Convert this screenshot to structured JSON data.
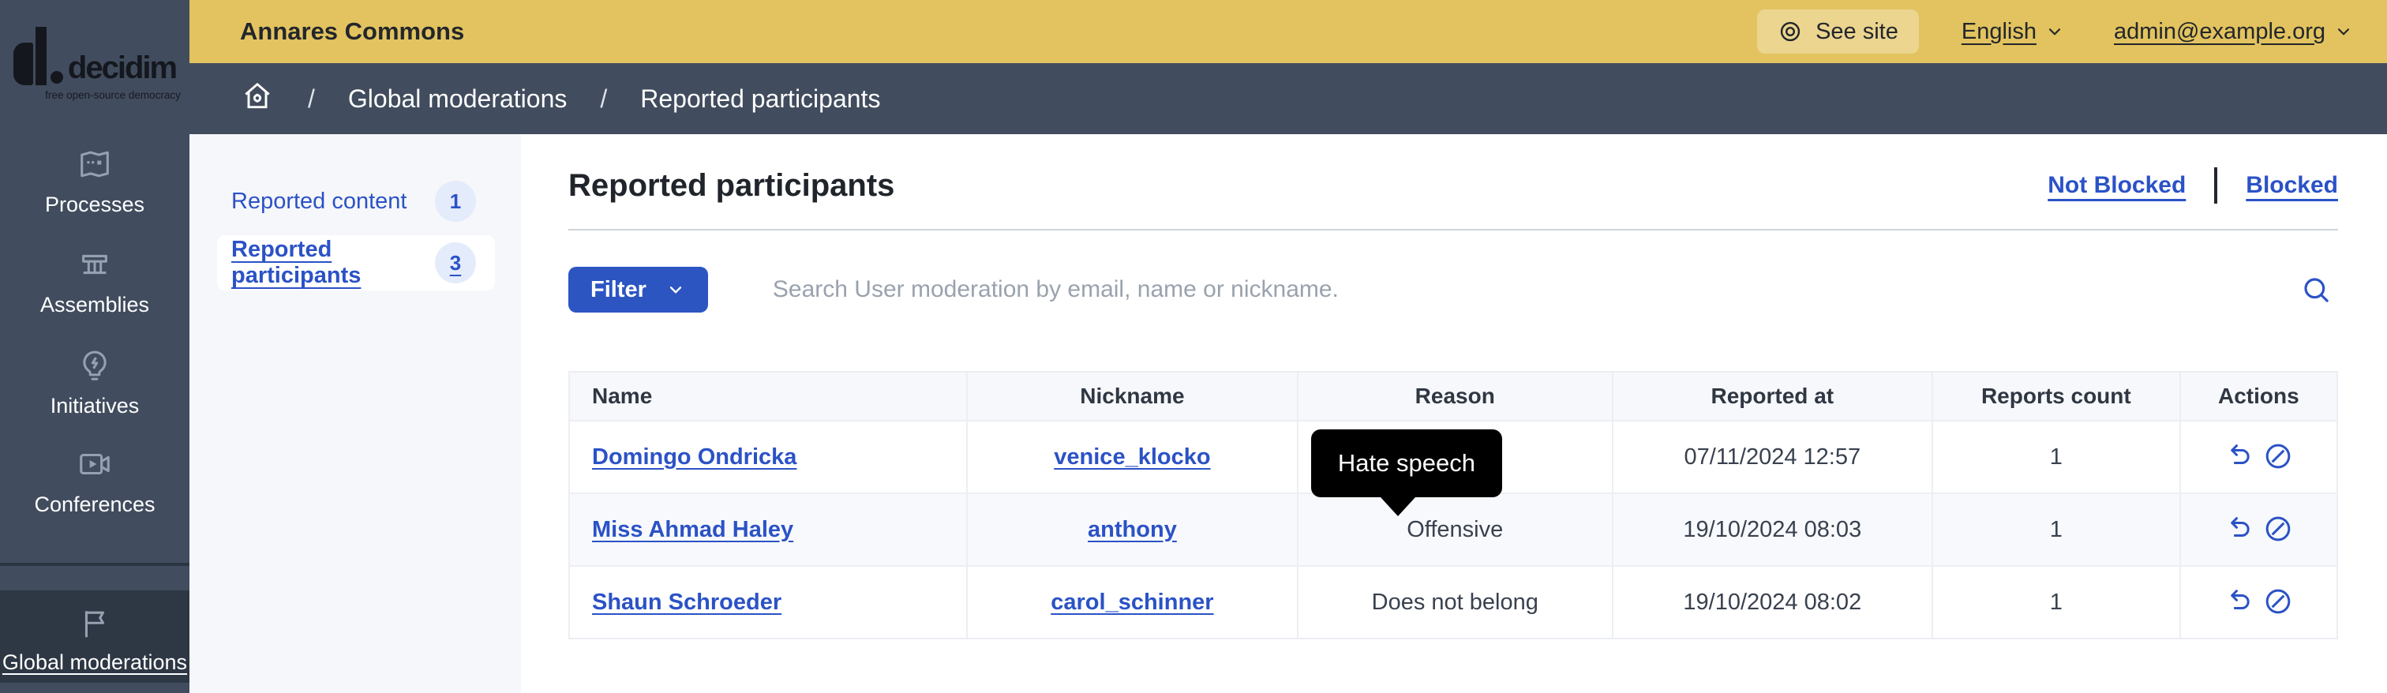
{
  "colors": {
    "header_bg": "#e2c35f",
    "sidebar_bg": "#414c5e",
    "sidebar_active_bg": "#2e3744",
    "link_blue": "#2b52c6",
    "filter_button_blue": "#2c55c2",
    "subsidebar_bg": "#f6f7fa",
    "table_header_bg": "#f7f8fb",
    "tooltip_bg": "#000000"
  },
  "logo": {
    "brand": "decidim",
    "tagline": "free open-source democracy"
  },
  "header": {
    "org_name": "Annares Commons",
    "see_site_label": "See site",
    "language_label": "English",
    "user_menu_label": "admin@example.org"
  },
  "breadcrumb": {
    "separator": "/",
    "items": [
      {
        "label": "Global moderations"
      },
      {
        "label": "Reported participants"
      }
    ]
  },
  "sidebar": {
    "items": [
      {
        "label": "Processes"
      },
      {
        "label": "Assemblies"
      },
      {
        "label": "Initiatives"
      },
      {
        "label": "Conferences"
      },
      {
        "label": "Global moderations"
      }
    ]
  },
  "subsidebar": {
    "items": [
      {
        "label": "Reported content",
        "count": "1"
      },
      {
        "label": "Reported participants",
        "count": "3"
      }
    ]
  },
  "main": {
    "title": "Reported participants",
    "status_filters": [
      {
        "label": "Not Blocked"
      },
      {
        "label": "Blocked"
      }
    ],
    "toolbar": {
      "filter_label": "Filter",
      "search_placeholder": "Search User moderation by email, name or nickname."
    },
    "tooltip": {
      "text": "Hate speech"
    },
    "table": {
      "headers": [
        "Name",
        "Nickname",
        "Reason",
        "Reported at",
        "Reports count",
        "Actions"
      ],
      "rows": [
        {
          "name": "Domingo Ondricka",
          "nickname": "venice_klocko",
          "reason": "",
          "reported_at": "07/11/2024 12:57",
          "reports_count": "1"
        },
        {
          "name": "Miss Ahmad Haley",
          "nickname": "anthony",
          "reason": "Offensive",
          "reported_at": "19/10/2024 08:03",
          "reports_count": "1"
        },
        {
          "name": "Shaun Schroeder",
          "nickname": "carol_schinner",
          "reason": "Does not belong",
          "reported_at": "19/10/2024 08:02",
          "reports_count": "1"
        }
      ]
    }
  }
}
